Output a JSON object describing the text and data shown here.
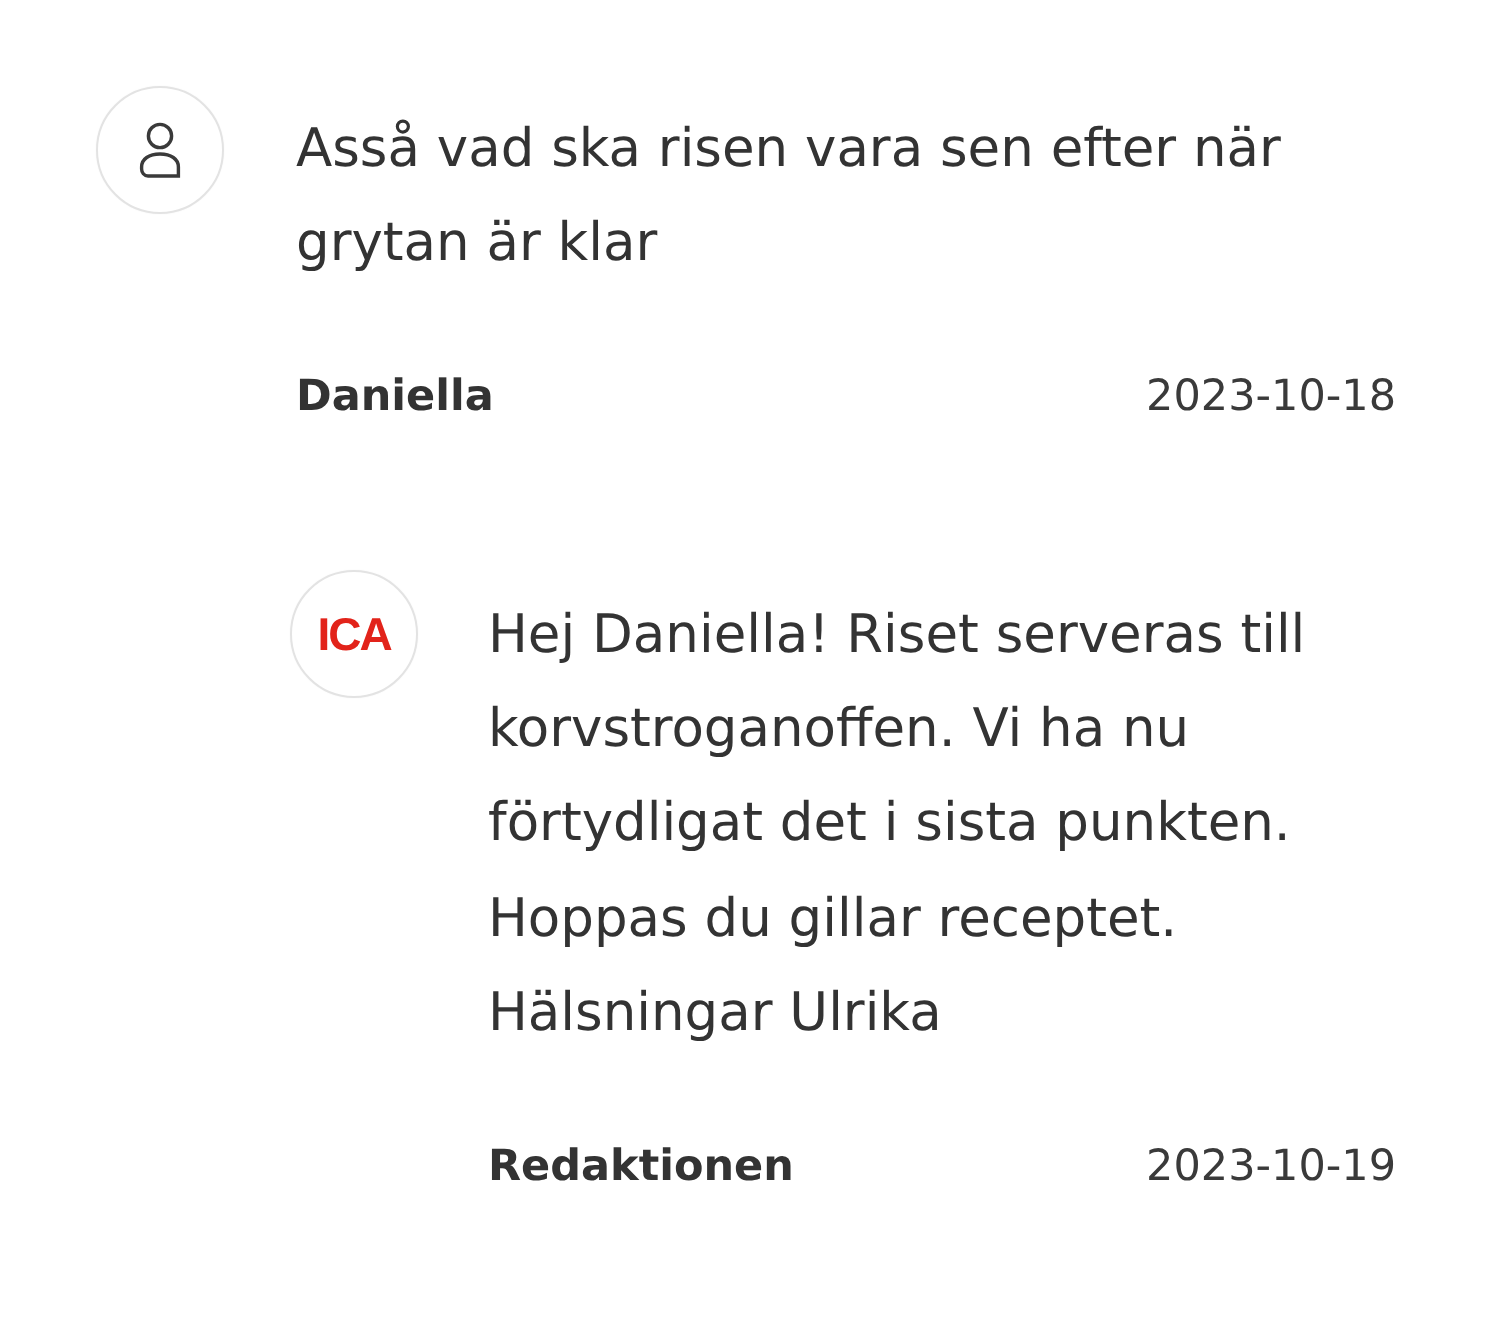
{
  "comments": [
    {
      "avatar": {
        "kind": "user"
      },
      "text": "Asså vad ska risen vara sen efter när grytan är klar",
      "author": "Daniella",
      "date": "2023-10-18",
      "replies": [
        {
          "avatar": {
            "kind": "logo",
            "text": "ICA"
          },
          "text": "Hej Daniella! Riset serveras till korvstroganoffen. Vi ha nu förtydligat det i sista punkten. Hoppas du gillar receptet. Hälsningar Ulrika",
          "author": "Redaktionen",
          "date": "2023-10-19"
        }
      ]
    }
  ]
}
